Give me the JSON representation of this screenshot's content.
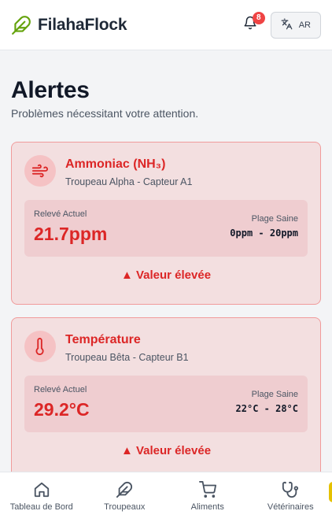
{
  "app": {
    "name": "FilahaFlock",
    "logo_icon": "feather-icon",
    "brand_color": "#65a30d"
  },
  "header": {
    "notifications_count": "8",
    "language_label": "AR",
    "language_icon": "translate-icon"
  },
  "page": {
    "title": "Alertes",
    "subtitle": "Problèmes nécessitant votre attention."
  },
  "alerts": [
    {
      "icon": "wind-icon",
      "title": "Ammoniac (NH₃)",
      "source": "Troupeau Alpha - Capteur A1",
      "reading_label": "Relevé Actuel",
      "reading_value": "21.7ppm",
      "range_label": "Plage Saine",
      "range_value": "0ppm - 20ppm",
      "status": "▲ Valeur élevée"
    },
    {
      "icon": "thermometer-icon",
      "title": "Température",
      "source": "Troupeau Bêta - Capteur B1",
      "reading_label": "Relevé Actuel",
      "reading_value": "29.2°C",
      "range_label": "Plage Saine",
      "range_value": "22°C - 28°C",
      "status": "▲ Valeur élevée"
    }
  ],
  "colors": {
    "alert_red": "#dc2626",
    "card_bg": "#f3dfe0",
    "card_border": "#f09b9b"
  },
  "bottom_nav": [
    {
      "label": "Tableau de Bord",
      "icon": "home-icon"
    },
    {
      "label": "Troupeaux",
      "icon": "feather-icon"
    },
    {
      "label": "Aliments",
      "icon": "cart-icon"
    },
    {
      "label": "Vétérinaires",
      "icon": "stethoscope-icon"
    }
  ]
}
